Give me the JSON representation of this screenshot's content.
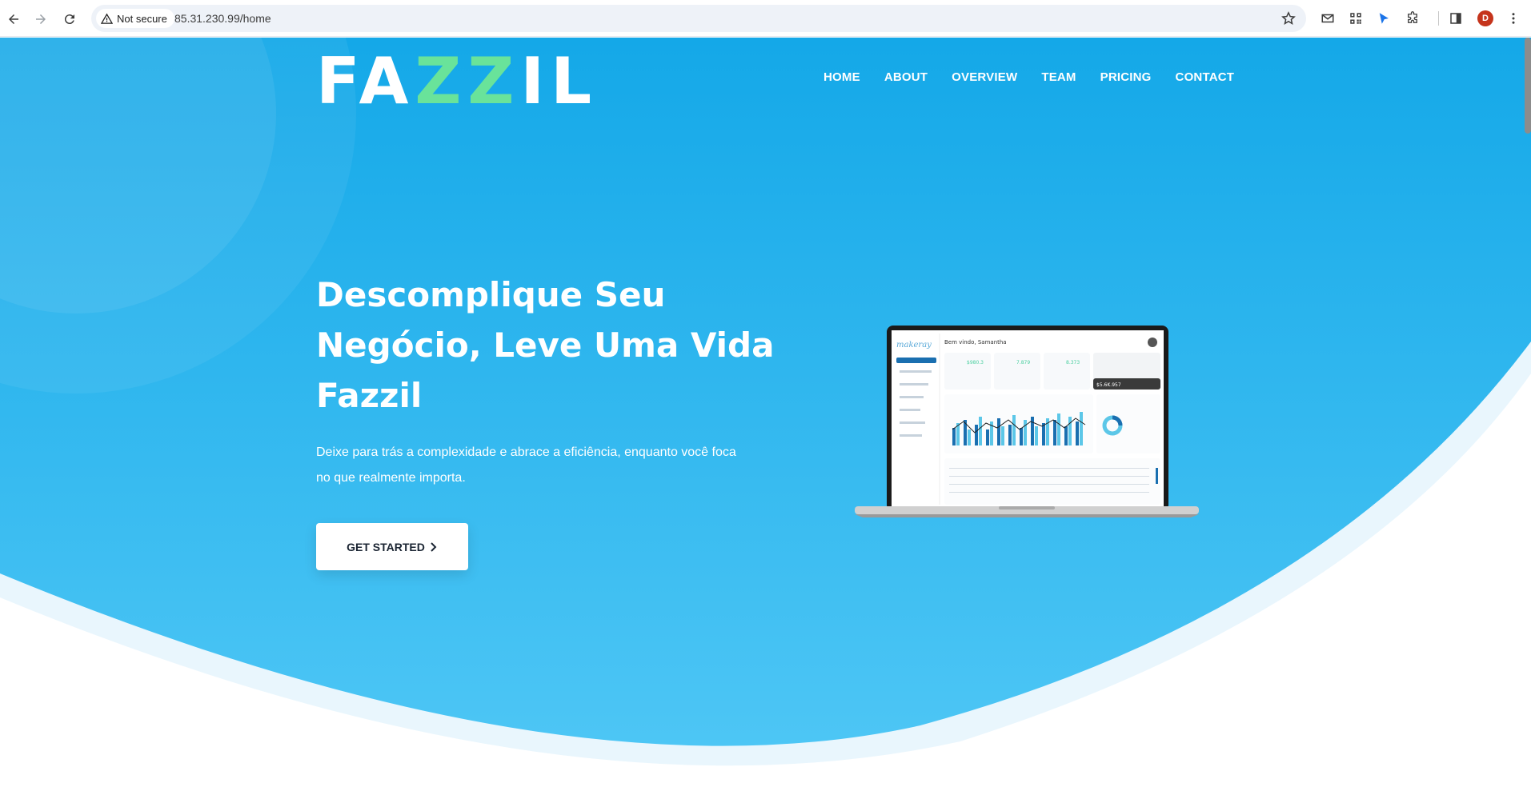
{
  "browser": {
    "security_label": "Not secure",
    "url": "85.31.230.99/home",
    "profile_initial": "D"
  },
  "site": {
    "logo_part1": "FA",
    "logo_part2": "ZZ",
    "logo_part3": "IL",
    "nav": [
      "HOME",
      "ABOUT",
      "OVERVIEW",
      "TEAM",
      "PRICING",
      "CONTACT"
    ],
    "hero": {
      "title": "Descomplique Seu Negócio, Leve Uma Vida Fazzil",
      "subtitle": "Deixe para trás a complexidade e abrace a eficiência, enquanto você foca no que realmente importa.",
      "cta_label": "GET STARTED"
    }
  },
  "mockup_dashboard": {
    "brand": "makeray",
    "greeting": "Bem vindo, Samantha",
    "stat_values": [
      "$980.3",
      "7.879",
      "8.373"
    ],
    "card_balance": "$5.6K.957"
  },
  "colors": {
    "hero_top": "#14a8e8",
    "hero_bottom": "#4dc6f5",
    "logo_accent": "#69e39a",
    "cta_text": "#1b2533"
  }
}
